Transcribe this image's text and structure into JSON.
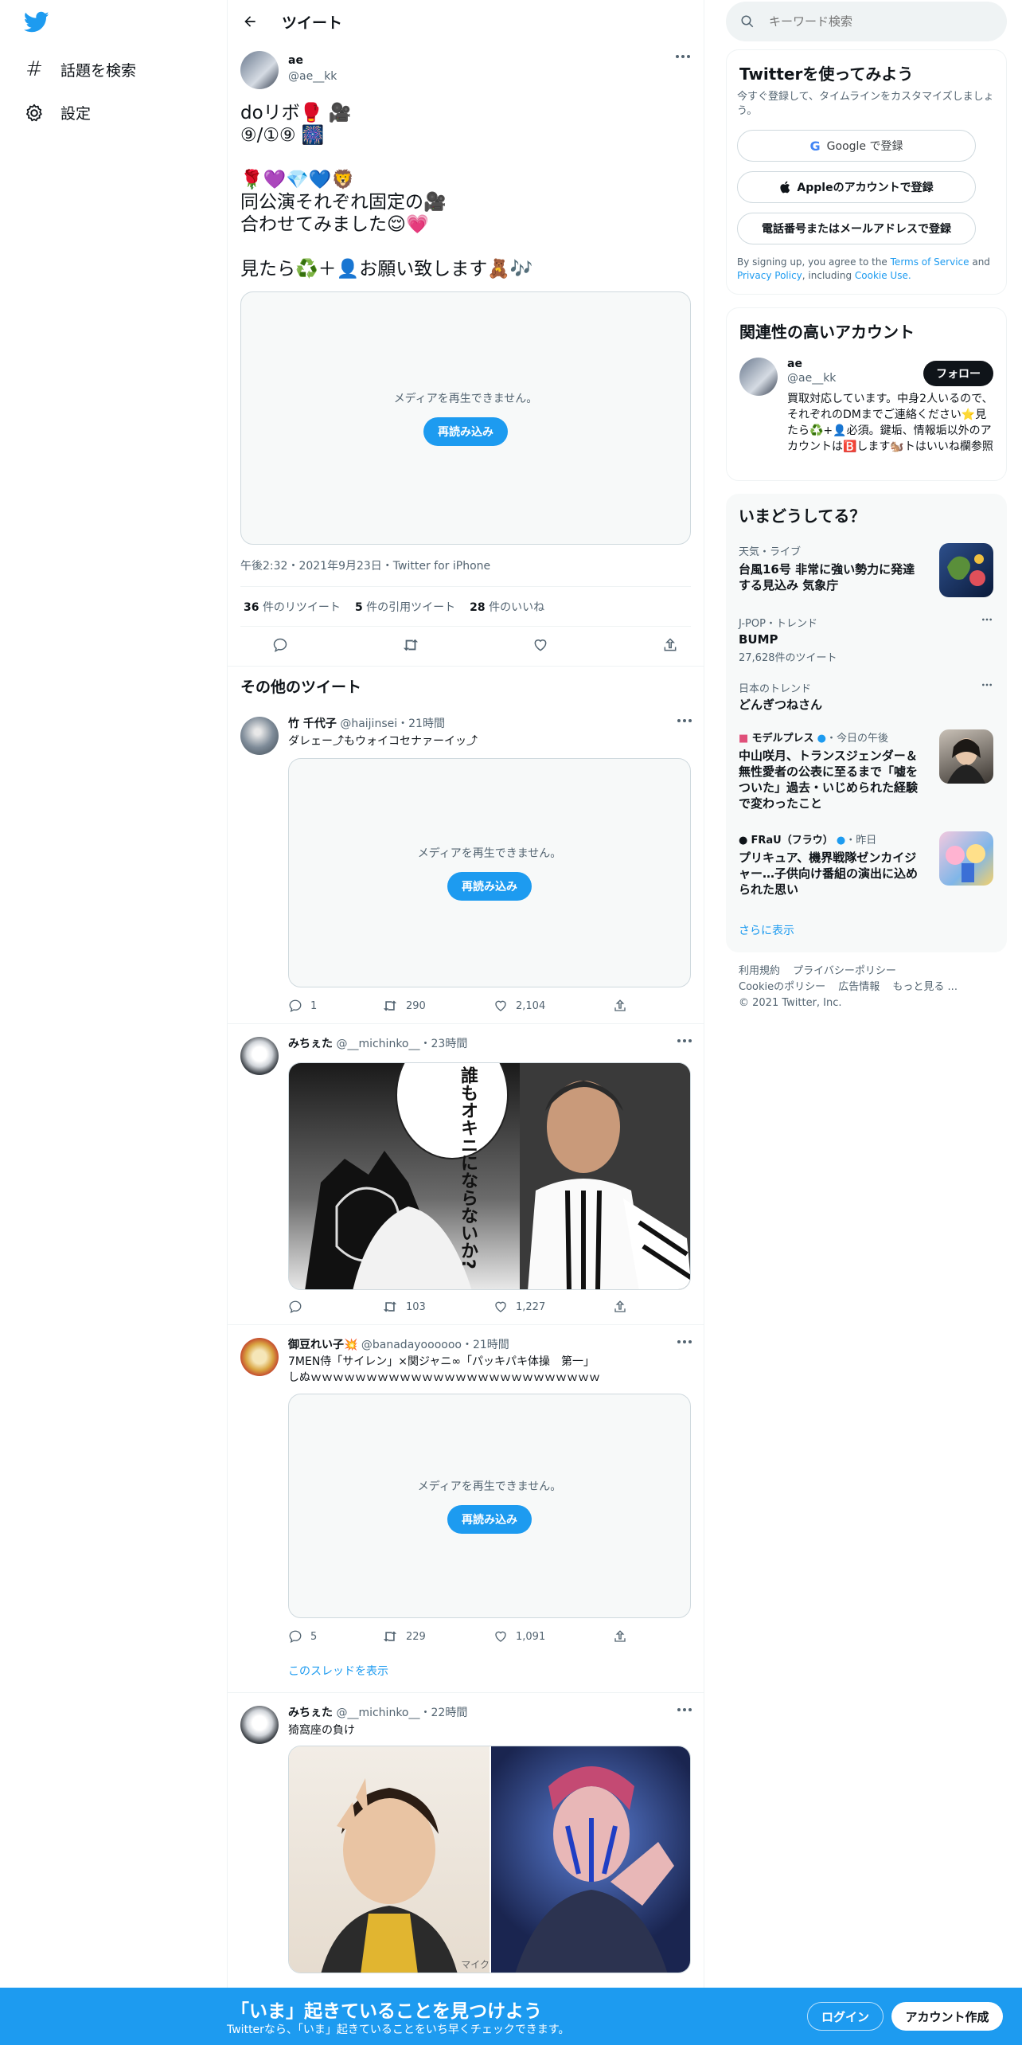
{
  "nav": {
    "explore_label": "話題を検索",
    "settings_label": "設定"
  },
  "header": {
    "title": "ツイート"
  },
  "main_tweet": {
    "name": "ae",
    "handle": "@ae__kk",
    "text_lines": [
      "doリボ🥊 🎥",
      "⑨/①⑨ 🎆",
      "",
      "🌹💜💎💙🦁",
      "同公演それぞれ固定の🎥",
      "合わせてみました😌💗",
      "",
      "見たら♻️＋👤お願い致します🧸🎶"
    ],
    "media_message": "メディアを再生できません。",
    "reload_label": "再読み込み",
    "timestamp": "午後2:32・2021年9月23日・Twitter for iPhone",
    "retweets_count": "36",
    "retweets_label": "件のリツイート",
    "quotes_count": "5",
    "quotes_label": "件の引用ツイート",
    "likes_count": "28",
    "likes_label": "件のいいね"
  },
  "more_tweets_heading": "その他のツイート",
  "tweets": [
    {
      "name": "竹 千代子",
      "handle": "@haijinsei",
      "time": "21時間",
      "text": "ダレェー⤴︎もウォイコセナァーイッ⤴︎",
      "media_message": "メディアを再生できません。",
      "reload_label": "再読み込み",
      "replies": "1",
      "retweets": "290",
      "likes": "2,104"
    },
    {
      "name": "みちぇた",
      "handle": "@__michinko__",
      "time": "23時間",
      "image_text": "誰もオキニにならないか?",
      "replies": "",
      "retweets": "103",
      "likes": "1,227"
    },
    {
      "name": "御豆れい子💥",
      "handle": "@banadayoooooo",
      "time": "21時間",
      "text": "7MEN侍「サイレン」×関ジャニ∞「パッキパキ体操　第一」",
      "text2": "しぬｗｗｗｗｗｗｗｗｗｗｗｗｗｗｗｗｗｗｗｗｗｗｗｗｗｗ",
      "media_message": "メディアを再生できません。",
      "reload_label": "再読み込み",
      "replies": "5",
      "retweets": "229",
      "likes": "1,091",
      "thread_link": "このスレッドを表示"
    },
    {
      "name": "みちぇた",
      "handle": "@__michinko__",
      "time": "22時間",
      "text": "猗窩座の負け",
      "image_caption": "マイク"
    }
  ],
  "search": {
    "placeholder": "キーワード検索"
  },
  "signup_card": {
    "title": "Twitterを使ってみよう",
    "subtitle": "今すぐ登録して、タイムラインをカスタマイズしましょう。",
    "google_label": "Google で登録",
    "apple_label": "Appleのアカウントで登録",
    "phone_label": "電話番号またはメールアドレスで登録",
    "terms_prefix": "By signing up, you agree to the ",
    "terms_link": "Terms of Service",
    "terms_and": " and",
    "privacy_link": "Privacy Policy",
    "terms_suffix": ", including ",
    "cookie_link": "Cookie Use."
  },
  "related_card": {
    "title": "関連性の高いアカウント",
    "name": "ae",
    "handle": "@ae__kk",
    "follow_label": "フォロー",
    "bio": "買取対応しています。中身2人いるので、それぞれのDMまでご連絡ください⭐見たら♻️+👤必須。鍵垢、情報垢以外のアカウントは🅱️します🐿️トはいいね欄参照"
  },
  "trends_card": {
    "title": "いまどうしてる？",
    "items": [
      {
        "category": "天気・ライブ",
        "title": "台風16号 非常に強い勢力に発達する見込み 気象庁"
      },
      {
        "category": "J-POP・トレンド",
        "title": "BUMP",
        "count": "27,628件のツイート"
      },
      {
        "category": "日本のトレンド",
        "title": "どんぎつねさん"
      },
      {
        "category_source": "モデルプレス",
        "category_time": "・今日の午後",
        "title": "中山咲月、トランスジェンダー＆無性愛者の公表に至るまで「嘘をついた」過去・いじめられた経験で変わったこと"
      },
      {
        "category_source": "FRaU（フラウ）",
        "category_time": "・昨日",
        "title": "プリキュア、機界戦隊ゼンカイジャー…子供向け番組の演出に込められた思い"
      }
    ],
    "show_more": "さらに表示"
  },
  "footer": {
    "terms": "利用規約",
    "privacy": "プライバシーポリシー",
    "cookie": "Cookieのポリシー",
    "ads": "広告情報",
    "more": "もっと見る ...",
    "copyright": "© 2021 Twitter, Inc."
  },
  "bottom_bar": {
    "headline": "「いま」起きていることを見つけよう",
    "sub": "Twitterなら、「いま」起きていることをいち早くチェックできます。",
    "login_label": "ログイン",
    "signup_label": "アカウント作成"
  },
  "colors": {
    "accent": "#1d9bf0",
    "text": "#0f1419",
    "secondary": "#536471",
    "border": "#eff3f4"
  }
}
